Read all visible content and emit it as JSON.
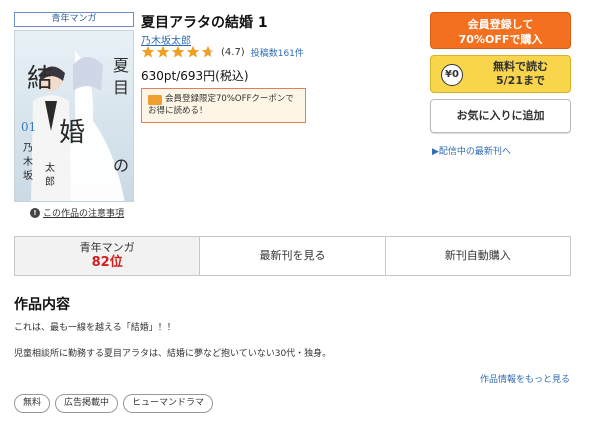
{
  "colors": {
    "register_button": "#f2701f",
    "free_button": "#f9d54c",
    "link": "#2f6bb3",
    "star": "#f0a020",
    "rank_value": "#d02020",
    "coupon_border": "#e07f5e"
  },
  "book": {
    "genre_tag": "青年マンガ",
    "title": "夏目アラタの結婚 1",
    "author": "乃木坂太郎",
    "rating_stars": 4.7,
    "rating_label": "(4.7)",
    "review_label": "投稿数161件",
    "price": "630pt/693円(税込)",
    "cover_title": "夏目アラタの結婚",
    "cover_author": "乃木坂太郎",
    "cover_volume": "01"
  },
  "coupon": {
    "line1": "会員登録限定70%OFFクーポンで",
    "line2": "お得に読める！"
  },
  "notice": {
    "icon": "info-icon",
    "label": "この作品の注意事項"
  },
  "actions": {
    "register_line1": "会員登録して",
    "register_line2": "70%OFFで購入",
    "free_icon": "yen-coin-icon",
    "free_icon_text": "¥0",
    "free_line1": "無料で読む",
    "free_line2": "5/21まで",
    "favorite": "お気に入りに追加",
    "latest_link": "▶配信中の最新刊へ"
  },
  "tabs": {
    "rank_label": "青年マンガ",
    "rank_value": "82位",
    "latest": "最新刊を見る",
    "auto_buy": "新刊自動購入"
  },
  "content": {
    "heading": "作品内容",
    "line1": "これは、最も一線を越える「結婚」！！",
    "line2": "児童相談所に勤務する夏目アラタは、結婚に夢など抱いていない30代・独身。",
    "more": "作品情報をもっと見る"
  },
  "tags": [
    "無料",
    "広告掲載中",
    "ヒューマンドラマ"
  ]
}
